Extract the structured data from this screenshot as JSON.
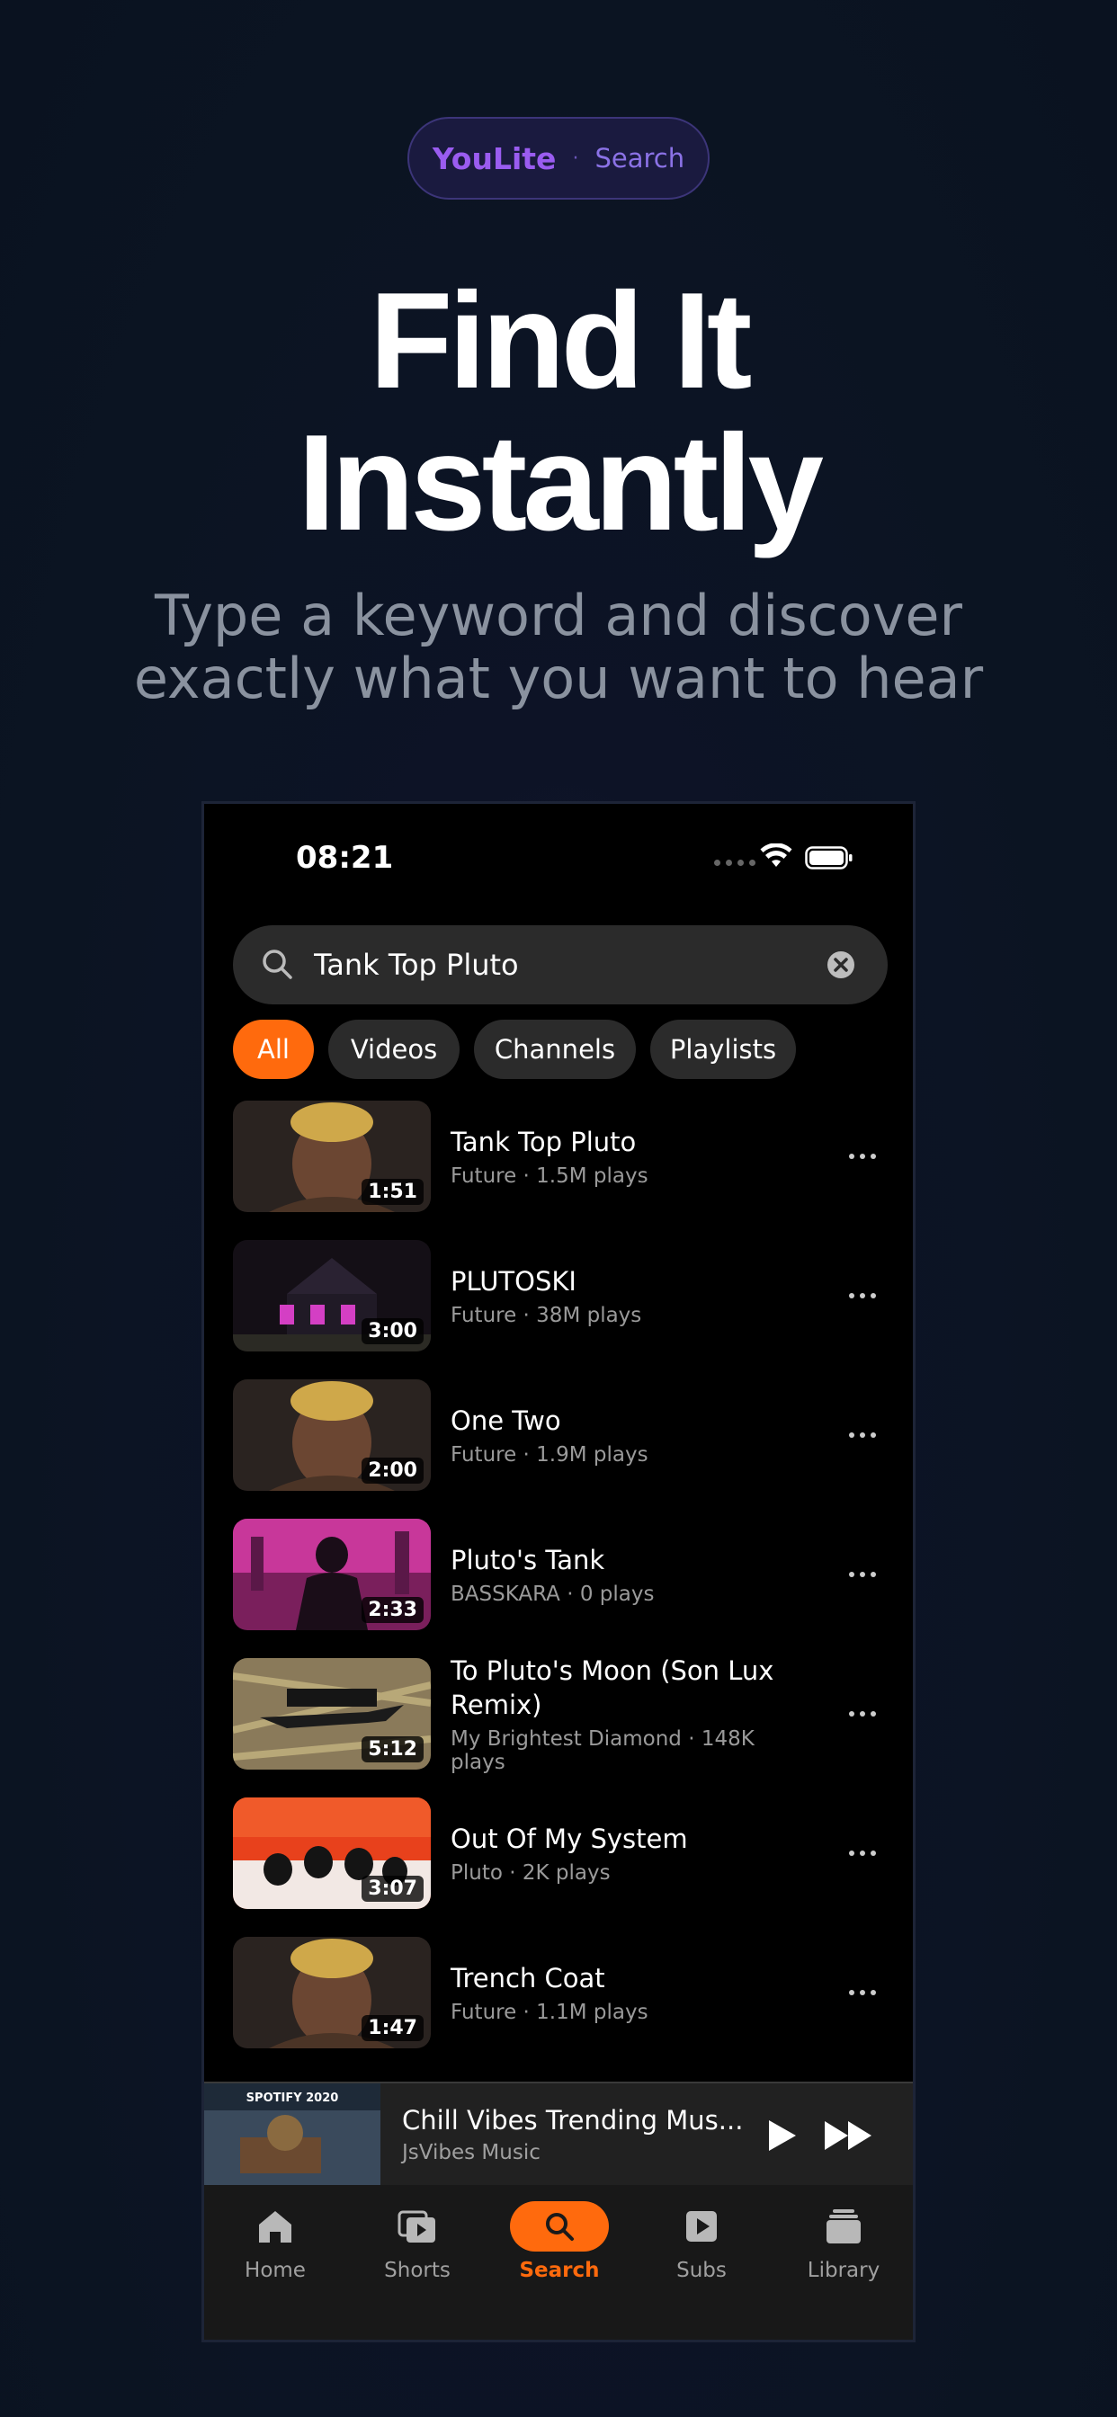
{
  "promo": {
    "brand": "YouLite",
    "separator": "·",
    "section": "Search",
    "headline_line1": "Find It",
    "headline_line2": "Instantly",
    "subtitle_line1": "Type a keyword and discover",
    "subtitle_line2": "exactly what you want to hear"
  },
  "status_bar": {
    "time": "08:21"
  },
  "search": {
    "query": "Tank Top Pluto"
  },
  "filters": [
    {
      "label": "All",
      "active": true
    },
    {
      "label": "Videos",
      "active": false
    },
    {
      "label": "Channels",
      "active": false
    },
    {
      "label": "Playlists",
      "active": false
    }
  ],
  "results": [
    {
      "title": "Tank Top Pluto",
      "meta": "Future · 1.5M plays",
      "duration": "1:51",
      "thumb_style": "future-portrait"
    },
    {
      "title": "PLUTOSKI",
      "meta": "Future · 38M plays",
      "duration": "3:00",
      "thumb_style": "pink-house"
    },
    {
      "title": "One Two",
      "meta": "Future · 1.9M plays",
      "duration": "2:00",
      "thumb_style": "future-portrait"
    },
    {
      "title": "Pluto's Tank",
      "meta": "BASSKARA · 0 plays",
      "duration": "2:33",
      "thumb_style": "pink-city"
    },
    {
      "title": "To Pluto's Moon (Son Lux Remix)",
      "meta": "My Brightest Diamond · 148K plays",
      "duration": "5:12",
      "thumb_style": "shark-paper"
    },
    {
      "title": "Out Of My System",
      "meta": "Pluto · 2K plays",
      "duration": "3:07",
      "thumb_style": "red-band"
    },
    {
      "title": "Trench Coat",
      "meta": "Future · 1.1M plays",
      "duration": "1:47",
      "thumb_style": "future-portrait"
    }
  ],
  "now_playing": {
    "title": "Chill Vibes Trending Mus...",
    "artist": "JsVibes Music",
    "thumb_text": "SPOTIFY 2020"
  },
  "tabs": [
    {
      "label": "Home",
      "icon": "home-icon",
      "active": false
    },
    {
      "label": "Shorts",
      "icon": "shorts-icon",
      "active": false
    },
    {
      "label": "Search",
      "icon": "search-icon",
      "active": true
    },
    {
      "label": "Subs",
      "icon": "subscriptions-icon",
      "active": false
    },
    {
      "label": "Library",
      "icon": "library-icon",
      "active": false
    }
  ],
  "colors": {
    "accent": "#ff6a0d",
    "brand": "#9a5cf0",
    "background": "#0b1422",
    "screen": "#000000"
  }
}
